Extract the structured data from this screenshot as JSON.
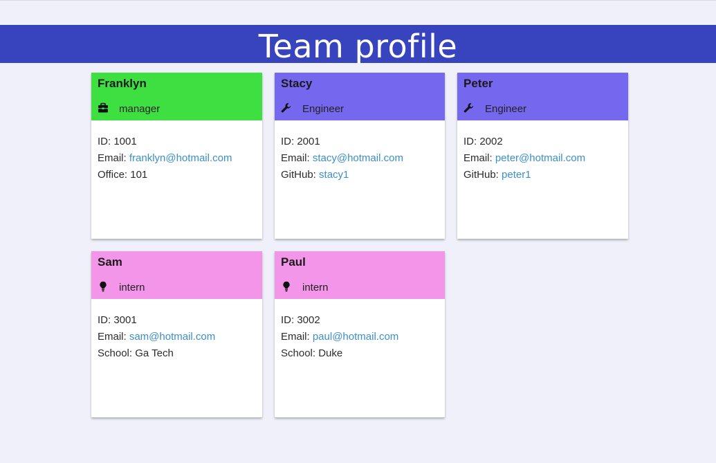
{
  "page": {
    "title": "Team profile"
  },
  "colors": {
    "header_bg": "#3843be",
    "manager": "#3ee041",
    "engineer": "#7668ee",
    "intern": "#f396e9",
    "link": "#3a8fcc",
    "page_bg": "#f0f0fa"
  },
  "cards": [
    {
      "name": "Franklyn",
      "role": "manager",
      "icon": "briefcase-icon",
      "id_label": "ID: ",
      "id": "1001",
      "email_label": "Email: ",
      "email": "franklyn@hotmail.com",
      "extra_label": "Office: ",
      "extra": "101"
    },
    {
      "name": "Stacy",
      "role": "Engineer",
      "icon": "wrench-icon",
      "id_label": "ID: ",
      "id": "2001",
      "email_label": "Email: ",
      "email": "stacy@hotmail.com",
      "extra_label": "GitHub: ",
      "extra": "stacy1"
    },
    {
      "name": "Peter",
      "role": "Engineer",
      "icon": "wrench-icon",
      "id_label": "ID: ",
      "id": "2002",
      "email_label": "Email: ",
      "email": "peter@hotmail.com",
      "extra_label": "GitHub: ",
      "extra": "peter1"
    },
    {
      "name": "Sam",
      "role": "intern",
      "icon": "lightbulb-icon",
      "id_label": "ID: ",
      "id": "3001",
      "email_label": "Email: ",
      "email": "sam@hotmail.com",
      "extra_label": "School: ",
      "extra": "Ga Tech"
    },
    {
      "name": "Paul",
      "role": "intern",
      "icon": "lightbulb-icon",
      "id_label": "ID: ",
      "id": "3002",
      "email_label": "Email: ",
      "email": "paul@hotmail.com",
      "extra_label": "School: ",
      "extra": "Duke"
    }
  ]
}
